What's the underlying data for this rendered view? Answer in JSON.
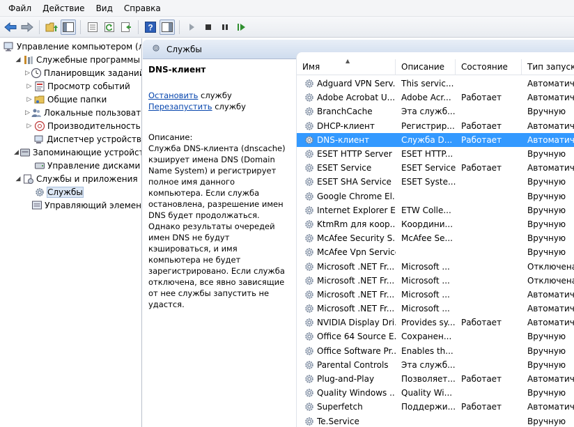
{
  "menu": [
    "Файл",
    "Действие",
    "Вид",
    "Справка"
  ],
  "tree": {
    "items": [
      {
        "label": "Управление компьютером (л",
        "level": 0,
        "expander": "",
        "icon": "computer-management-icon"
      },
      {
        "label": "Служебные программы",
        "level": 1,
        "expander": "◢",
        "icon": "tools-icon"
      },
      {
        "label": "Планировщик заданий",
        "level": 2,
        "expander": "▷",
        "icon": "clock-icon"
      },
      {
        "label": "Просмотр событий",
        "level": 2,
        "expander": "▷",
        "icon": "event-viewer-icon"
      },
      {
        "label": "Общие папки",
        "level": 2,
        "expander": "▷",
        "icon": "shared-folder-icon"
      },
      {
        "label": "Локальные пользовате",
        "level": 2,
        "expander": "▷",
        "icon": "users-icon"
      },
      {
        "label": "Производительность",
        "level": 2,
        "expander": "▷",
        "icon": "performance-icon"
      },
      {
        "label": "Диспетчер устройств",
        "level": 2,
        "expander": "",
        "icon": "device-manager-icon"
      },
      {
        "label": "Запоминающие устройст",
        "level": 1,
        "expander": "◢",
        "icon": "storage-icon"
      },
      {
        "label": "Управление дисками",
        "level": 2,
        "expander": "",
        "icon": "disk-icon"
      },
      {
        "label": "Службы и приложения",
        "level": 1,
        "expander": "◢",
        "icon": "services-apps-icon"
      },
      {
        "label": "Службы",
        "level": 2,
        "expander": "",
        "icon": "gear-icon",
        "selected": true
      },
      {
        "label": "Управляющий элемен",
        "level": 2,
        "expander": "",
        "icon": "wmi-icon"
      }
    ]
  },
  "header": {
    "title": "Службы"
  },
  "desc_pane": {
    "service_title": "DNS-клиент",
    "stop_link": "Остановить",
    "stop_suffix": " службу",
    "restart_link": "Перезапустить",
    "restart_suffix": " службу",
    "desc_label": "Описание:",
    "desc_text": "Служба DNS-клиента (dnscache) кэширует имена DNS (Domain Name System) и регистрирует полное имя данного компьютера. Если служба остановлена, разрешение имен DNS будет продолжаться. Однако результаты очередей имен DNS не будут кэшироваться, и имя компьютера не будет зарегистрировано. Если служба отключена, все явно зависящие от нее службы запустить не удастся."
  },
  "columns": [
    "Имя",
    "Описание",
    "Состояние",
    "Тип запуск"
  ],
  "sort_indicator": "▲",
  "rows": [
    {
      "name": "Adguard VPN Serv...",
      "desc": "This servic...",
      "state": "",
      "start": "Автоматич"
    },
    {
      "name": "Adobe Acrobat U...",
      "desc": "Adobe Acr...",
      "state": "Работает",
      "start": "Автоматич"
    },
    {
      "name": "BranchCache",
      "desc": "Эта служб...",
      "state": "",
      "start": "Вручную"
    },
    {
      "name": "DHCP-клиент",
      "desc": "Регистрир...",
      "state": "Работает",
      "start": "Автоматич"
    },
    {
      "name": "DNS-клиент",
      "desc": "Служба D...",
      "state": "Работает",
      "start": "Автоматич",
      "selected": true
    },
    {
      "name": "ESET HTTP Server",
      "desc": "ESET HTTP...",
      "state": "",
      "start": "Вручную"
    },
    {
      "name": "ESET Service",
      "desc": "ESET Service",
      "state": "Работает",
      "start": "Автоматич"
    },
    {
      "name": "ESET SHA Service",
      "desc": "ESET Syste...",
      "state": "",
      "start": "Вручную"
    },
    {
      "name": "Google Chrome El...",
      "desc": "",
      "state": "",
      "start": "Вручную"
    },
    {
      "name": "Internet Explorer E...",
      "desc": "ETW Colle...",
      "state": "",
      "start": "Вручную"
    },
    {
      "name": "KtmRm для коор...",
      "desc": "Координи...",
      "state": "",
      "start": "Вручную"
    },
    {
      "name": "McAfee Security S...",
      "desc": "McAfee Se...",
      "state": "",
      "start": "Вручную"
    },
    {
      "name": "McAfee Vpn Service",
      "desc": "",
      "state": "",
      "start": "Вручную"
    },
    {
      "name": "Microsoft .NET Fr...",
      "desc": "Microsoft ...",
      "state": "",
      "start": "Отключена"
    },
    {
      "name": "Microsoft .NET Fr...",
      "desc": "Microsoft ...",
      "state": "",
      "start": "Отключена"
    },
    {
      "name": "Microsoft .NET Fr...",
      "desc": "Microsoft ...",
      "state": "",
      "start": "Автоматич"
    },
    {
      "name": "Microsoft .NET Fr...",
      "desc": "Microsoft ...",
      "state": "",
      "start": "Автоматич"
    },
    {
      "name": "NVIDIA Display Dri...",
      "desc": "Provides sy...",
      "state": "Работает",
      "start": "Автоматич"
    },
    {
      "name": "Office 64 Source E...",
      "desc": "Сохранен...",
      "state": "",
      "start": "Вручную"
    },
    {
      "name": "Office Software Pr...",
      "desc": "Enables th...",
      "state": "",
      "start": "Вручную"
    },
    {
      "name": "Parental Controls",
      "desc": "Эта служб...",
      "state": "",
      "start": "Вручную"
    },
    {
      "name": "Plug-and-Play",
      "desc": "Позволяет...",
      "state": "Работает",
      "start": "Автоматич"
    },
    {
      "name": "Quality Windows ...",
      "desc": "Quality Wi...",
      "state": "",
      "start": "Вручную"
    },
    {
      "name": "Superfetch",
      "desc": "Поддержи...",
      "state": "Работает",
      "start": "Автоматич"
    },
    {
      "name": "Te.Service",
      "desc": "",
      "state": "",
      "start": "Вручную"
    }
  ]
}
